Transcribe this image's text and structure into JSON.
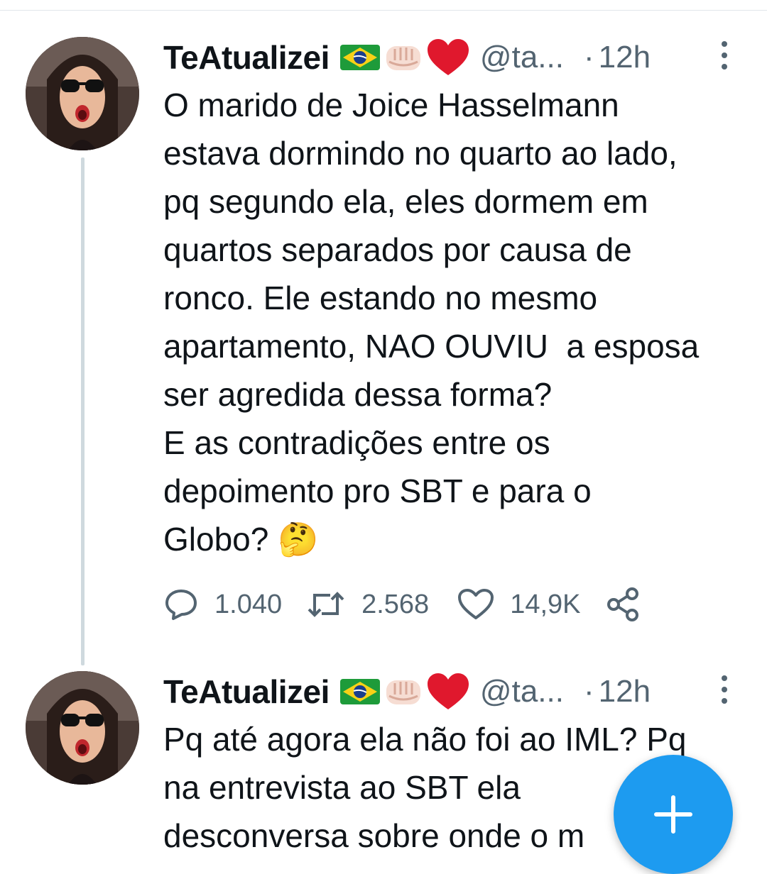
{
  "tweets": [
    {
      "author": {
        "name": "TeAtualizei",
        "handle": "@ta...",
        "emoji_icons": [
          "brazil-flag-icon",
          "raised-fist-icon",
          "red-heart-icon"
        ]
      },
      "time": "12h",
      "separator": "·",
      "text": "O marido de Joice Hasselmann\nestava dormindo no quarto ao lado,\npq segundo ela, eles dormem em\nquartos separados por causa de\nronco. Ele estando no mesmo\napartamento, NAO OUVIU  a esposa\nser agredida dessa forma?\nE as contradições entre os\ndepoimento pro SBT e para o\nGlobo? 🤔",
      "stats": {
        "replies": "1.040",
        "retweets": "2.568",
        "likes": "14,9K"
      }
    },
    {
      "author": {
        "name": "TeAtualizei",
        "handle": "@ta...",
        "emoji_icons": [
          "brazil-flag-icon",
          "raised-fist-icon",
          "red-heart-icon"
        ]
      },
      "time": "12h",
      "separator": "·",
      "text": "Pq até agora ela não foi ao IML? Pq\nna entrevista ao SBT ela\ndesconversa sobre onde o m"
    }
  ],
  "colors": {
    "accent": "#1d9bf0",
    "secondary_text": "#536471",
    "thread_line": "#cfd9de"
  },
  "fab": {
    "icon": "plus-icon"
  }
}
